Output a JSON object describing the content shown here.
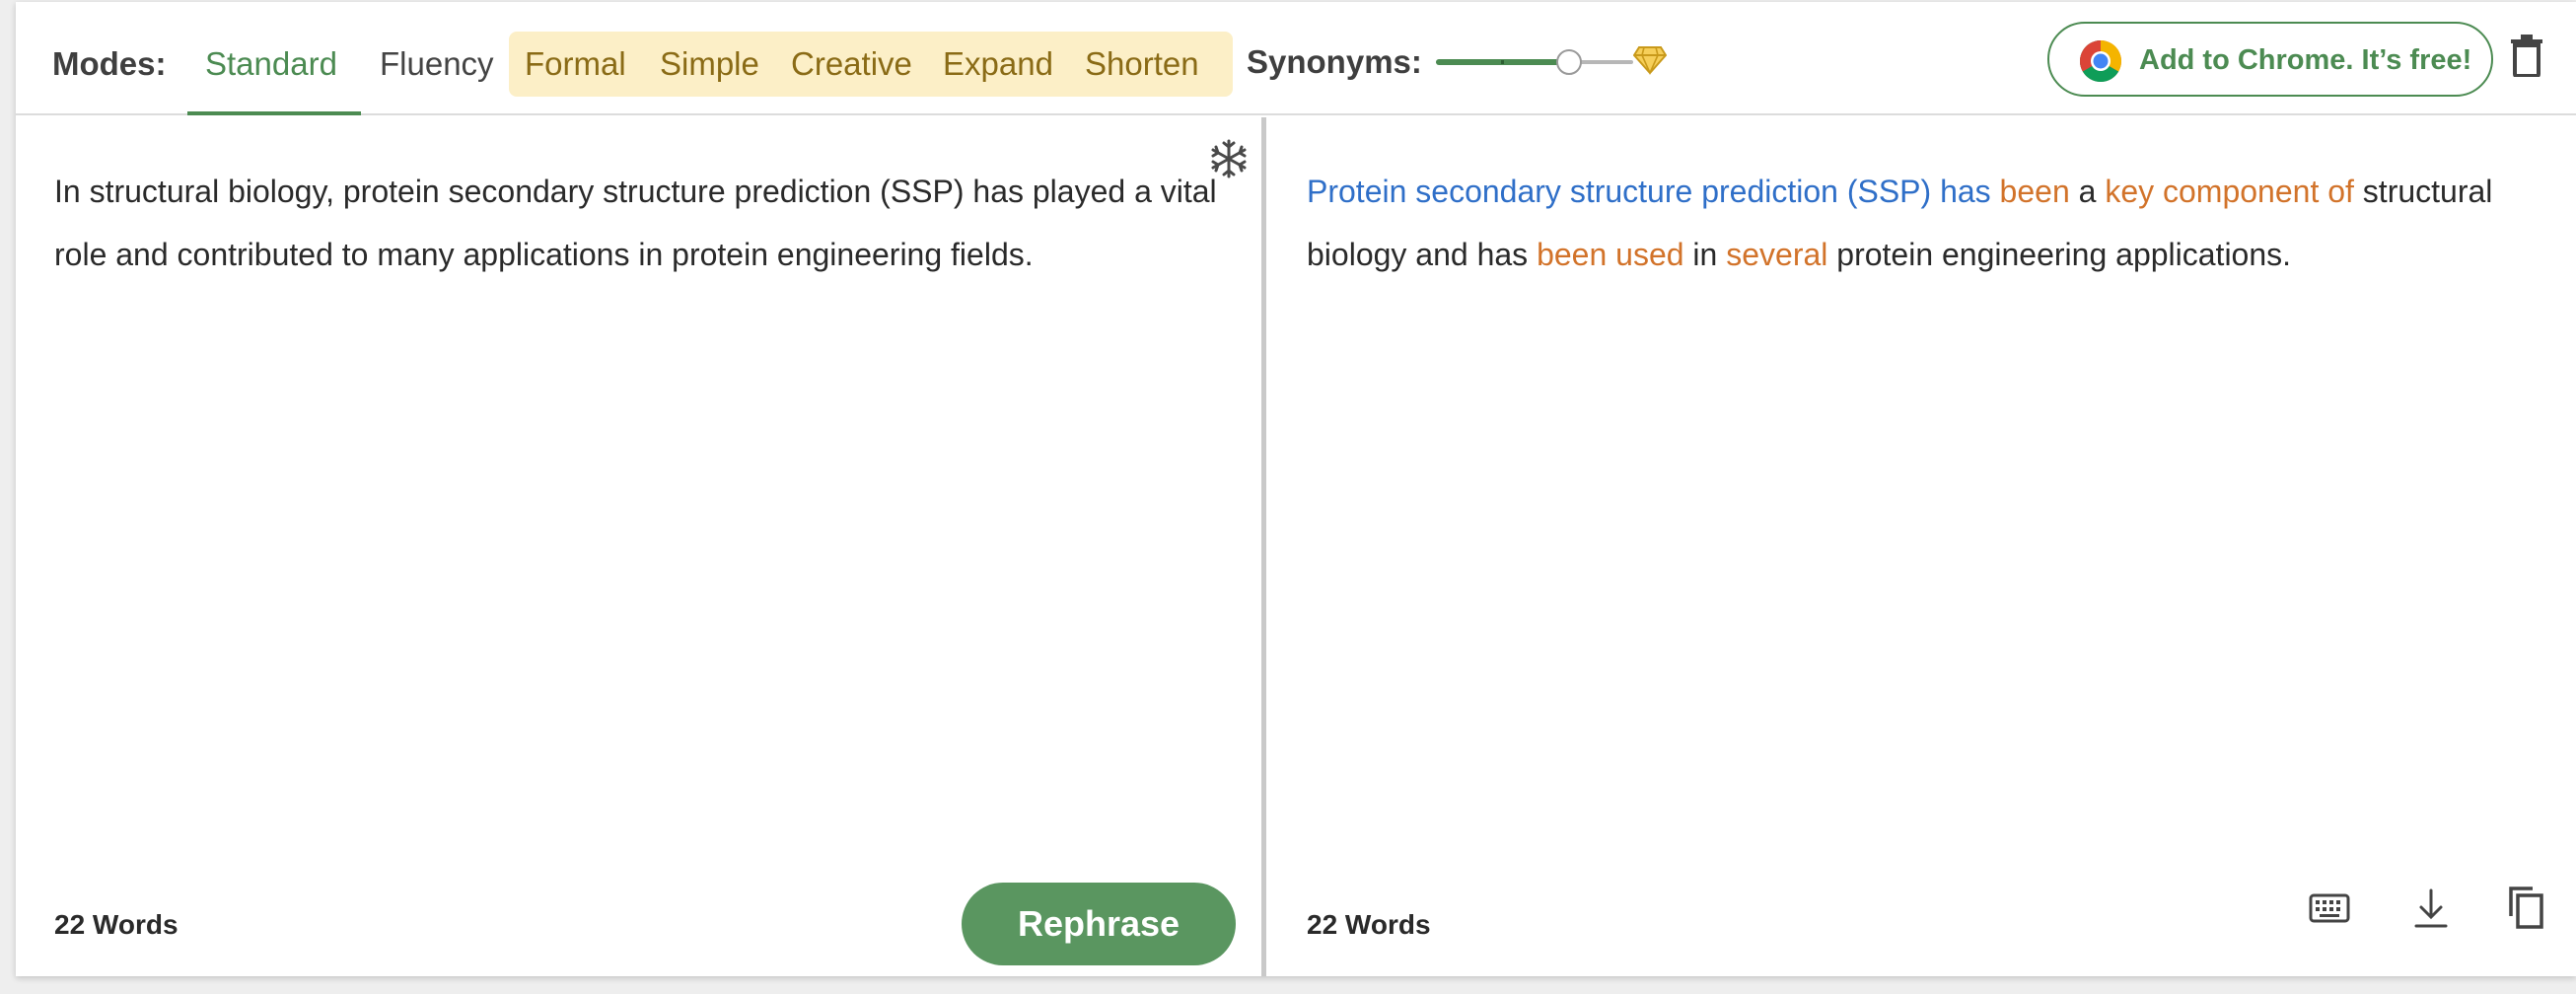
{
  "toolbar": {
    "modes_label": "Modes:",
    "modes": [
      {
        "label": "Standard",
        "active": true,
        "premium": false
      },
      {
        "label": "Fluency",
        "active": false,
        "premium": false
      },
      {
        "label": "Formal",
        "active": false,
        "premium": true
      },
      {
        "label": "Simple",
        "active": false,
        "premium": true
      },
      {
        "label": "Creative",
        "active": false,
        "premium": true
      },
      {
        "label": "Expand",
        "active": false,
        "premium": true
      },
      {
        "label": "Shorten",
        "active": false,
        "premium": true
      }
    ],
    "synonyms_label": "Synonyms:",
    "synonyms_level": 0.68,
    "chrome_button_label": "Add to Chrome. It’s free!",
    "icons": [
      "diamond-icon",
      "chrome-logo-icon",
      "trash-icon"
    ]
  },
  "input_pane": {
    "text": "In structural biology, protein secondary structure prediction (SSP) has played a vital role and contributed to many applications in protein engineering fields.",
    "word_count": "22 Words",
    "rephrase_label": "Rephrase",
    "icons": [
      "freeze-words-icon"
    ]
  },
  "output_pane": {
    "segments": [
      {
        "text": "Protein secondary structure prediction (SSP) has",
        "style": "blue"
      },
      {
        "text": " ",
        "style": "plain"
      },
      {
        "text": "been",
        "style": "orange"
      },
      {
        "text": " a ",
        "style": "plain"
      },
      {
        "text": "key component of",
        "style": "orange"
      },
      {
        "text": " structural biology and has ",
        "style": "plain"
      },
      {
        "text": "been used",
        "style": "orange"
      },
      {
        "text": " in ",
        "style": "plain"
      },
      {
        "text": "several",
        "style": "orange"
      },
      {
        "text": " protein engineering applications.",
        "style": "plain"
      }
    ],
    "word_count": "22 Words",
    "icons": [
      "keyboard-icon",
      "download-icon",
      "copy-icon"
    ]
  },
  "colors": {
    "accent_green": "#4c8b52",
    "rephrase_green": "#5a9660",
    "premium_bg": "#fcefc7",
    "premium_text": "#8a6b16",
    "changed_blue": "#2f6fc8",
    "changed_orange": "#d2732a"
  }
}
